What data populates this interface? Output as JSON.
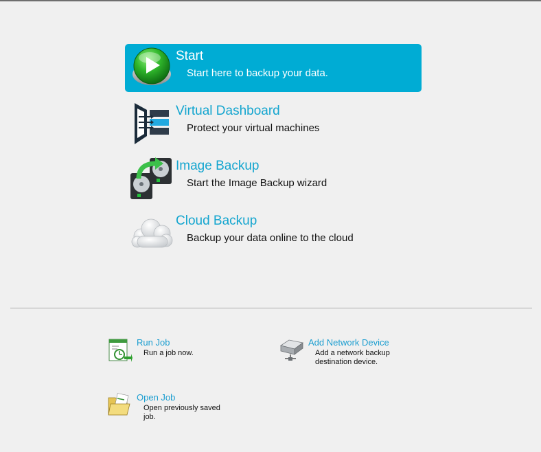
{
  "main_actions": [
    {
      "title": "Start",
      "description": "Start here to backup your data.",
      "icon": "play-button-icon",
      "selected": true
    },
    {
      "title": "Virtual Dashboard",
      "description": "Protect your virtual machines",
      "icon": "virtual-dashboard-icon"
    },
    {
      "title": "Image Backup",
      "description": "Start the Image Backup wizard",
      "icon": "image-backup-icon"
    },
    {
      "title": "Cloud Backup",
      "description": "Backup your data online to the cloud",
      "icon": "cloud-icon"
    }
  ],
  "quick_actions": [
    {
      "title": "Run Job",
      "description": "Run a job now.",
      "icon": "run-job-icon"
    },
    {
      "title": "Add Network Device",
      "description": "Add a network backup\ndestination device.",
      "icon": "network-device-icon"
    },
    {
      "title": "Open Job",
      "description": "Open previously saved\njob.",
      "icon": "folder-open-icon"
    }
  ],
  "colors": {
    "accent": "#00acd4",
    "link": "#13a5cf",
    "background": "#f0f0f0"
  }
}
